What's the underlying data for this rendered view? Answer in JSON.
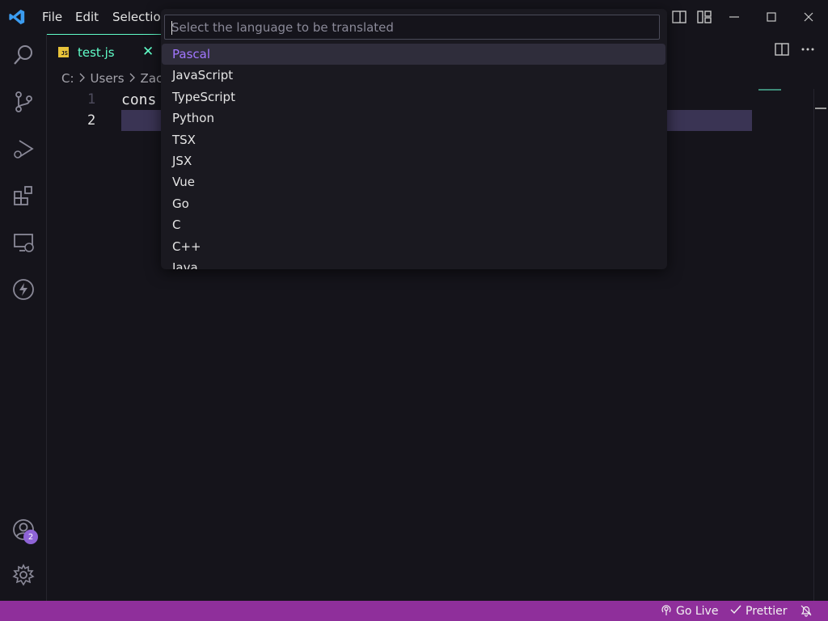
{
  "titlebar": {
    "menus": [
      "File",
      "Edit",
      "Selectio"
    ]
  },
  "tab": {
    "badge": "JS",
    "label": "test.js",
    "close": "✕"
  },
  "breadcrumb": {
    "items": [
      "C:",
      "Users",
      "Zacl"
    ]
  },
  "editor": {
    "line_numbers": [
      "1",
      "2"
    ],
    "code_line_1": "cons"
  },
  "quickpick": {
    "placeholder": "Select the language to be translated",
    "items": [
      "Pascal",
      "JavaScript",
      "TypeScript",
      "Python",
      "TSX",
      "JSX",
      "Vue",
      "Go",
      "C",
      "C++",
      "Java"
    ],
    "selected": "Pascal"
  },
  "activitybar": {
    "accounts_badge": "2"
  },
  "statusbar": {
    "go_live": "Go Live",
    "prettier": "Prettier"
  },
  "colors": {
    "accent": "#a277ff",
    "tab_accent": "#61ffca",
    "statusbar": "#8f2f9b",
    "background": "#15141b"
  }
}
